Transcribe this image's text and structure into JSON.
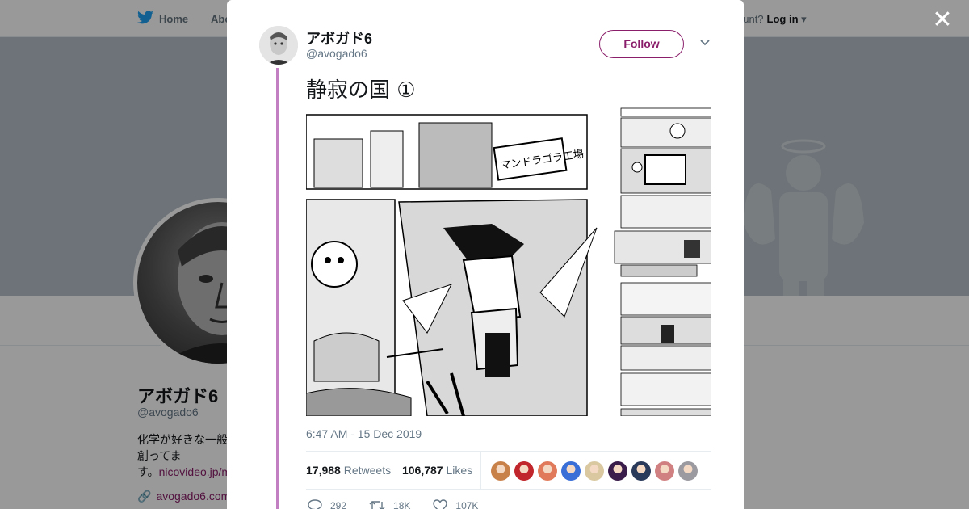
{
  "topbar": {
    "home_label": "Home",
    "about_label": "Abo",
    "account_prompt": "ccount?",
    "login_label": "Log in"
  },
  "profile": {
    "name": "アボガド6",
    "handle": "@avogado6",
    "bio_line1": "化学が好きな一般",
    "bio_line2": "創ってま",
    "bio_line3_prefix": "す。",
    "bio_link": "nicovideo.jp/m",
    "url": "avogado6.com"
  },
  "tweet": {
    "author_name": "アボガド6",
    "author_handle": "@avogado6",
    "follow_label": "Follow",
    "text": "静寂の国 ①",
    "media_sign": "マンドラゴラ工場",
    "timestamp": "6:47 AM - 15 Dec 2019",
    "retweets_count": "17,988",
    "retweets_label": "Retweets",
    "likes_count": "106,787",
    "likes_label": "Likes",
    "reply_count": "292",
    "retweet_action_count": "18K",
    "like_action_count": "107K",
    "liker_colors": [
      "#c9814a",
      "#c0262b",
      "#e07a5a",
      "#3b6fd8",
      "#d9c8a0",
      "#3a1d4a",
      "#2a3a5a",
      "#d08080",
      "#9a9aa0"
    ]
  },
  "colors": {
    "accent": "#8a1e6a",
    "thread": "#c27fc2",
    "overlay": "rgba(0,0,0,0.4)"
  }
}
